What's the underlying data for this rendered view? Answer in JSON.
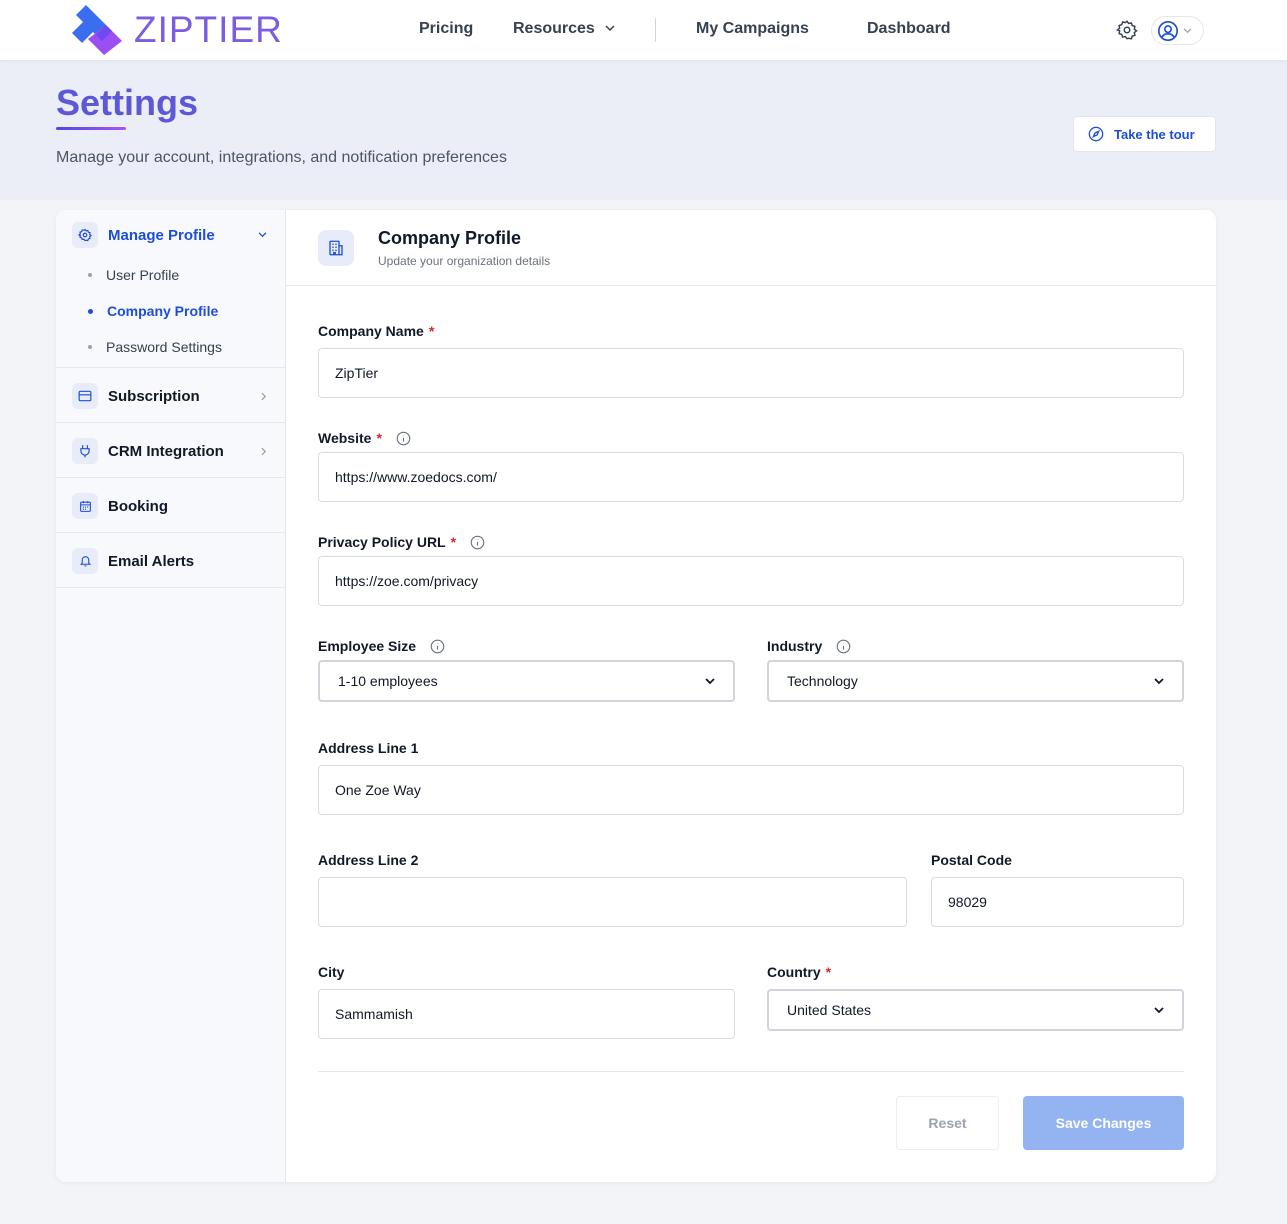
{
  "nav": {
    "logo_text": "ZIPTIER",
    "links": [
      "Pricing",
      "Resources",
      "My Campaigns",
      "Dashboard"
    ]
  },
  "header": {
    "title": "Settings",
    "subtitle": "Manage your account, integrations, and notification preferences",
    "tour_label": "Take the tour"
  },
  "sidebar": {
    "manage_profile": "Manage Profile",
    "sub_items": [
      "User Profile",
      "Company Profile",
      "Password Settings"
    ],
    "subscription": "Subscription",
    "crm": "CRM Integration",
    "booking": "Booking",
    "email_alerts": "Email Alerts"
  },
  "main": {
    "title": "Company Profile",
    "subtitle": "Update your organization details"
  },
  "form": {
    "company_name_label": "Company Name",
    "company_name_value": "ZipTier",
    "website_label": "Website",
    "website_value": "https://www.zoedocs.com/",
    "privacy_label": "Privacy Policy URL",
    "privacy_value": "https://zoe.com/privacy",
    "employee_label": "Employee Size",
    "employee_value": "1-10 employees",
    "industry_label": "Industry",
    "industry_value": "Technology",
    "address1_label": "Address Line 1",
    "address1_value": "One Zoe Way",
    "address2_label": "Address Line 2",
    "address2_value": "",
    "postal_label": "Postal Code",
    "postal_value": "98029",
    "city_label": "City",
    "city_value": "Sammamish",
    "country_label": "Country",
    "country_value": "United States",
    "required_mark": "*"
  },
  "actions": {
    "reset": "Reset",
    "save": "Save Changes"
  },
  "colors": {
    "accent": "#1d4ed8",
    "title": "#5c58d6",
    "required": "#dc2626",
    "save_disabled": "#93b4f1"
  }
}
